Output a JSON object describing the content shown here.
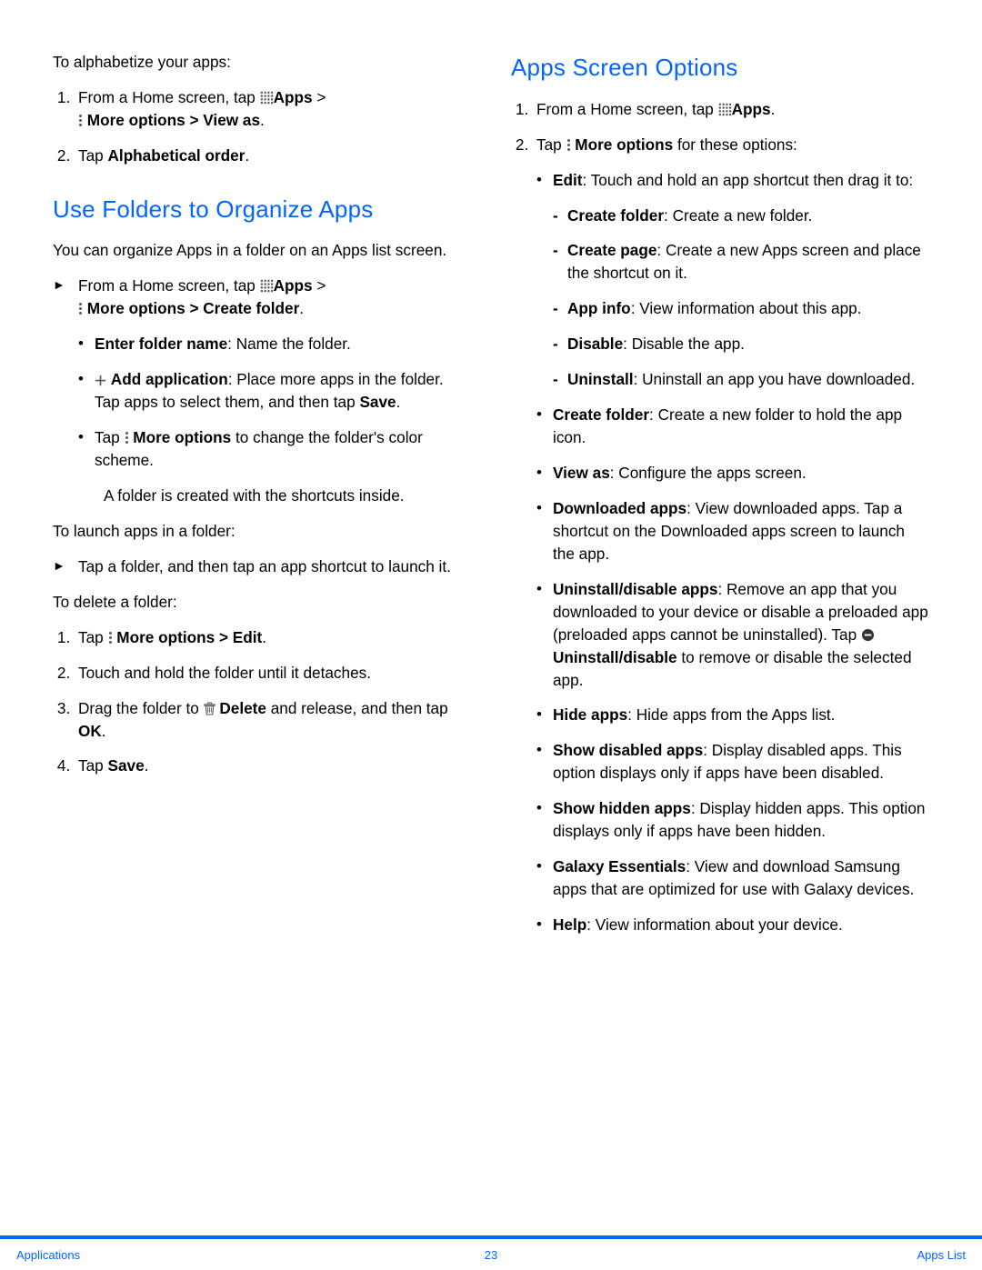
{
  "left": {
    "intro": "To alphabetize your apps:",
    "step1a": "From a Home screen, tap ",
    "step1b": "Apps",
    "step1c": " > ",
    "step1d": "More options",
    "step1e": " > View as",
    "step1f": ".",
    "step2a": "Tap ",
    "step2b": "Alphabetical order",
    "step2c": ".",
    "heading": "Use Folders to Organize Apps",
    "p1": "You can organize Apps in a folder on an Apps list screen.",
    "pt1a": "From a Home screen, tap ",
    "pt1b": "Apps",
    "pt1c": " > ",
    "pt1d": "More options",
    "pt1e": " > Create folder",
    "pt1f": ".",
    "b1a": "Enter folder name",
    "b1b": ": Name the folder.",
    "b2a": "Add application",
    "b2b": ": Place more apps in the folder. Tap apps to select them, and then tap ",
    "b2c": "Save",
    "b2d": ".",
    "b3a": "Tap ",
    "b3b": "More options",
    "b3c": " to change the folder's color scheme.",
    "p2": "A folder is created with the shortcuts inside.",
    "launch_intro": "To launch apps in a folder:",
    "launch": "Tap a folder, and then tap an app shortcut to launch it.",
    "delete_intro": "To delete a folder:",
    "d1a": "Tap ",
    "d1b": "More options",
    "d1c": " > Edit",
    "d1d": ".",
    "d2": "Touch and hold the folder until it detaches.",
    "d3a": "Drag the folder to ",
    "d3b": "Delete",
    "d3c": " and release, and then tap ",
    "d3d": "OK",
    "d3e": ".",
    "d4a": "Tap ",
    "d4b": "Save",
    "d4c": "."
  },
  "right": {
    "heading": "Apps Screen Options",
    "s1a": "From a Home screen, tap ",
    "s1b": "Apps",
    "s1c": ".",
    "s2a": "Tap ",
    "s2b": "More options",
    "s2c": " for these options:",
    "e1a": "Edit",
    "e1b": ": Touch and hold an app shortcut then drag it to:",
    "e_cf_a": "Create folder",
    "e_cf_b": ": Create a new folder.",
    "e_cp_a": "Create page",
    "e_cp_b": ": Create a new Apps screen and place the shortcut on it.",
    "e_ai_a": "App info",
    "e_ai_b": ": View information about this app.",
    "e_di_a": "Disable",
    "e_di_b": ": Disable the app.",
    "e_un_a": "Uninstall",
    "e_un_b": ": Uninstall an app you have downloaded.",
    "cf_a": "Create folder",
    "cf_b": ": Create a new folder to hold the app icon.",
    "va_a": "View as",
    "va_b": ": Configure the apps screen.",
    "da_a": "Downloaded apps",
    "da_b": ": View downloaded apps. Tap a shortcut on the Downloaded apps screen to launch the app.",
    "ud_a": "Uninstall/disable apps",
    "ud_b": ": Remove an app that you downloaded to your device or disable a preloaded app (preloaded apps cannot be uninstalled). Tap ",
    "ud_c": "Uninstall/disable",
    "ud_d": " to remove or disable the selected app.",
    "ha_a": "Hide apps",
    "ha_b": ": Hide apps from the Apps list.",
    "sd_a": "Show disabled apps",
    "sd_b": ": Display disabled apps. This option displays only if apps have been disabled.",
    "sh_a": "Show hidden apps",
    "sh_b": ": Display hidden apps. This option displays only if apps have been hidden.",
    "ge_a": "Galaxy Essentials",
    "ge_b": ": View and download Samsung apps that are optimized for use with Galaxy devices.",
    "hp_a": "Help",
    "hp_b": ": View information about your device."
  },
  "footer": {
    "left": "Applications",
    "center": "23",
    "right": "Apps List"
  }
}
